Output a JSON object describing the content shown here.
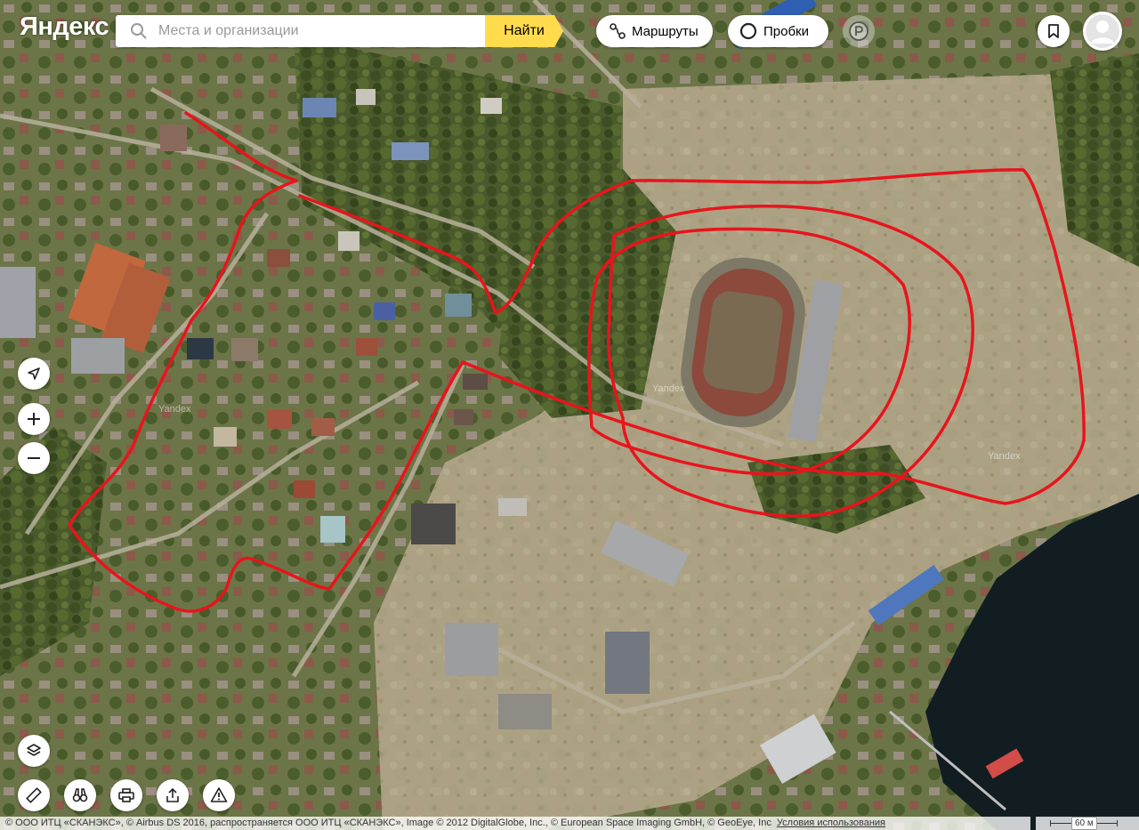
{
  "header": {
    "logo": "Яндекс",
    "search_placeholder": "Места и организации",
    "search_button": "Найти",
    "routes_label": "Маршруты",
    "traffic_label": "Пробки"
  },
  "map": {
    "type": "satellite",
    "watermark": "Yandex",
    "route_color": "#e8141c",
    "water_color": "#121d22"
  },
  "footer": {
    "attribution": "© ООО ИТЦ «СКАНЭКС», © Airbus DS 2016, распространяется ООО ИТЦ «СКАНЭКС», Image © 2012 DigitalGlobe, Inc., © European Space Imaging GmbH, © GeoEye, Inc",
    "terms_link": "Условия использования",
    "scale_label": "60 м"
  },
  "controls": {
    "icons": [
      "location-arrow-icon",
      "plus-icon",
      "minus-icon",
      "layers-icon",
      "ruler-icon",
      "binoculars-icon",
      "printer-icon",
      "share-icon",
      "warning-icon"
    ]
  }
}
